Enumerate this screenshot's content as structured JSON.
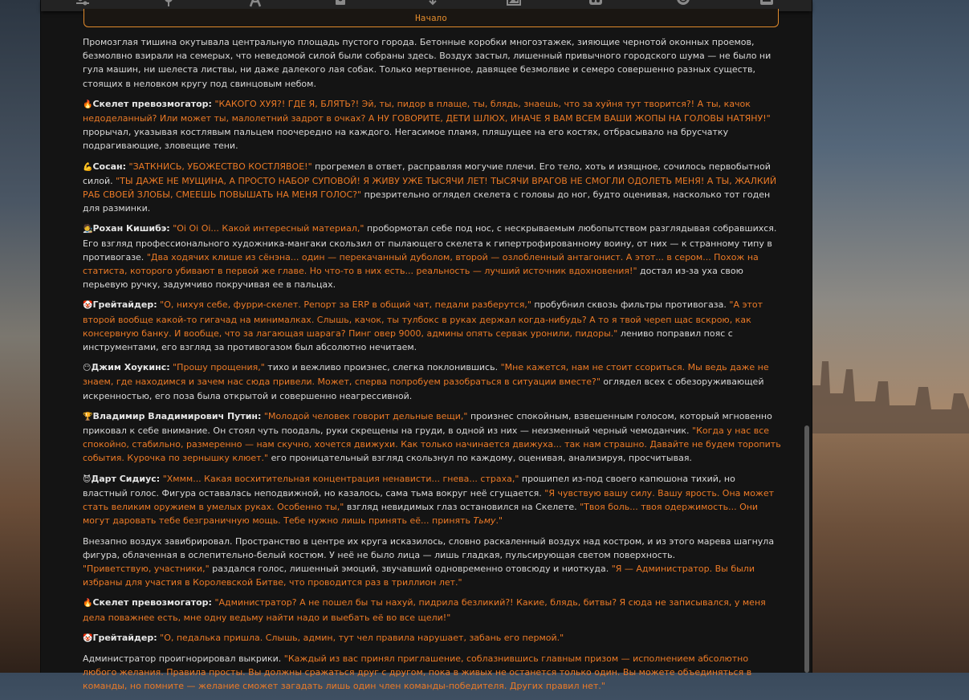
{
  "start_label": "Начало",
  "toolbar_icons": [
    "sliders-icon",
    "pin-icon",
    "font-icon",
    "journal-icon",
    "image-icon",
    "vr-icon",
    "smile-icon",
    "menu-card-icon"
  ],
  "paragraphs": [
    [
      {
        "t": "Промозглая тишина окутывала центральную площадь пустого города. Бетонные коробки многоэтажек, зияющие чернотой оконных проемов, безмолвно взирали на семерых, что неведомой силой были собраны здесь. Воздух застыл, лишенный привычного городского шума — не было ни гула машин, ни шелеста листвы, ни даже далекого лая собак. Только мертвенное, давящее безмолвие и семеро совершенно разных существ, стоящих в неловком кругу под свинцовым небом.",
        "s": "n"
      }
    ],
    [
      {
        "t": "🔥",
        "s": "e"
      },
      {
        "t": "Скелет превозмогатор:",
        "s": "b"
      },
      {
        "t": " ",
        "s": "n"
      },
      {
        "t": "\"КАКОГО ХУЯ?! ГДЕ Я, БЛЯТЬ?! Эй, ты, пидор в плаще, ты, блядь, знаешь, что за хуйня тут творится?! А ты, качок недоделанный? Или может ты, малолетний задрот в очках? А НУ ГОВОРИТЕ, ДЕТИ ШЛЮХ, ИНАЧЕ Я ВАМ ВСЕМ ВАШИ ЖОПЫ НА ГОЛОВЫ НАТЯНУ!\"",
        "s": "q"
      },
      {
        "t": " прорычал, указывая костлявым пальцем поочередно на каждого. Негасимое пламя, пляшущее на его костях, отбрасывало на брусчатку подрагивающие, зловещие тени.",
        "s": "n"
      }
    ],
    [
      {
        "t": "💪",
        "s": "e"
      },
      {
        "t": "Сосан:",
        "s": "b"
      },
      {
        "t": " ",
        "s": "n"
      },
      {
        "t": "\"ЗАТКНИСЬ, УБОЖЕСТВО КОСТЛЯВОЕ!\"",
        "s": "q"
      },
      {
        "t": " прогремел в ответ, расправляя могучие плечи. Его тело, хоть и изящное, сочилось первобытной силой. ",
        "s": "n"
      },
      {
        "t": "\"ТЫ ДАЖЕ НЕ МУЩИНА, А ПРОСТО НАБОР СУПОВОЙ! Я ЖИВУ УЖЕ ТЫСЯЧИ ЛЕТ! ТЫСЯЧИ ВРАГОВ НЕ СМОГЛИ ОДОЛЕТЬ МЕНЯ! А ТЫ, ЖАЛКИЙ РАБ СВОЕЙ ЗЛОБЫ, СМЕЕШЬ ПОВЫШАТЬ НА МЕНЯ ГОЛОС?\"",
        "s": "q"
      },
      {
        "t": " презрительно оглядел скелета с головы до ног, будто оценивая, насколько тот годен для разминки.",
        "s": "n"
      }
    ],
    [
      {
        "t": "🧑‍🎨",
        "s": "e"
      },
      {
        "t": "Рохан Кишибэ:",
        "s": "b"
      },
      {
        "t": " ",
        "s": "n"
      },
      {
        "t": "\"Oi Oi Oi... Какой интересный материал,\"",
        "s": "q"
      },
      {
        "t": " пробормотал себе под нос, с нескрываемым любопытством разглядывая собравшихся. Его взгляд профессионального художника-мангаки скользил от пылающего скелета к гипертрофированному воину, от них — к странному типу в противогазе. ",
        "s": "n"
      },
      {
        "t": "\"Два ходячих клише из сёнэна... один — перекачанный дуболом, второй — озлобленный антагонист. А этот... в сером... Похож на статиста, которого убивают в первой же главе. Но что-то в них есть... реальность — лучший источник вдохновения!\"",
        "s": "q"
      },
      {
        "t": " достал из-за уха свою перьевую ручку, задумчиво покручивая ее в пальцах.",
        "s": "n"
      }
    ],
    [
      {
        "t": "🤡",
        "s": "e"
      },
      {
        "t": "Грейтайдер:",
        "s": "b"
      },
      {
        "t": " ",
        "s": "n"
      },
      {
        "t": "\"О, нихуя себе, фурри-скелет. Репорт за ERP в общий чат, педали разберутся,\"",
        "s": "q"
      },
      {
        "t": " пробубнил сквозь фильтры противогаза. ",
        "s": "n"
      },
      {
        "t": "\"А этот второй вообще какой-то гигачад на минималках. Слышь, качок, ты тулбокс в руках держал когда-нибудь? А то я твой череп щас вскрою, как консервную банку. И вообще, что за лагающая шарага? Пинг овер 9000, админы опять сервак уронили, пидоры.\"",
        "s": "q"
      },
      {
        "t": " лениво поправил пояс с инструментами, его взгляд за противогазом был абсолютно нечитаем.",
        "s": "n"
      }
    ],
    [
      {
        "t": "😶",
        "s": "e"
      },
      {
        "t": "Джим Хоукинс:",
        "s": "b"
      },
      {
        "t": " ",
        "s": "n"
      },
      {
        "t": "\"Прошу прощения,\"",
        "s": "q"
      },
      {
        "t": " тихо и вежливо произнес, слегка поклонившись. ",
        "s": "n"
      },
      {
        "t": "\"Мне кажется, нам не стоит ссориться. Мы ведь даже не знаем, где находимся и зачем нас сюда привели. Может, сперва попробуем разобраться в ситуации вместе?\"",
        "s": "q"
      },
      {
        "t": " оглядел всех с обезоруживающей искренностью, его поза была открытой и совершенно неагрессивной.",
        "s": "n"
      }
    ],
    [
      {
        "t": "🏆",
        "s": "e"
      },
      {
        "t": "Владимир Владимирович Путин:",
        "s": "b"
      },
      {
        "t": " ",
        "s": "n"
      },
      {
        "t": "\"Молодой человек говорит дельные вещи,\"",
        "s": "q"
      },
      {
        "t": " произнес спокойным, взвешенным голосом, который мгновенно приковал к себе внимание. Он стоял чуть поодаль, руки скрещены на груди, в одной из них — неизменный черный чемоданчик. ",
        "s": "n"
      },
      {
        "t": "\"Когда у нас все спокойно, стабильно, размеренно — нам скучно, хочется движухи. Как только начинается движуха... так нам страшно. Давайте не будем торопить события. Курочка по зернышку клюет.\"",
        "s": "q"
      },
      {
        "t": " его проницательный взгляд скользнул по каждому, оценивая, анализируя, просчитывая.",
        "s": "n"
      }
    ],
    [
      {
        "t": "😈",
        "s": "e"
      },
      {
        "t": "Дарт Сидиус:",
        "s": "b"
      },
      {
        "t": " ",
        "s": "n"
      },
      {
        "t": "\"Хммм... Какая восхитительная концентрация ненависти... гнева... страха,\"",
        "s": "q"
      },
      {
        "t": " прошипел из-под своего капюшона тихий, но властный голос. Фигура оставалась неподвижной, но казалось, сама тьма вокруг неё сгущается. ",
        "s": "n"
      },
      {
        "t": "\"Я чувствую вашу силу. Вашу ярость. Она может стать великим оружием в умелых руках. Особенно ты,\"",
        "s": "q"
      },
      {
        "t": " взгляд невидимых глаз остановился на Скелете. ",
        "s": "n"
      },
      {
        "t": "\"Твоя боль... твоя одержимость... Они могут даровать тебе безграничную мощь. Тебе нужно лишь принять её... принять ",
        "s": "q"
      },
      {
        "t": "Тьму",
        "s": "qi"
      },
      {
        "t": ".\"",
        "s": "q"
      }
    ],
    [
      {
        "t": "Внезапно воздух завибрировал. Пространство в центре их круга исказилось, словно раскаленный воздух над костром, и из этого марева шагнула фигура, облаченная в ослепительно-белый костюм. У неё не было лица — лишь гладкая, пульсирующая светом поверхность.",
        "s": "n"
      },
      {
        "t": "\n",
        "s": "br"
      },
      {
        "t": "\"Приветствую, участники,\"",
        "s": "q"
      },
      {
        "t": " раздался голос, лишенный эмоций, звучавший одновременно отовсюду и ниоткуда. ",
        "s": "n"
      },
      {
        "t": "\"Я — Администратор. Вы были избраны для участия в Королевской Битве, что проводится раз в триллион лет.\"",
        "s": "q"
      }
    ],
    [
      {
        "t": "🔥",
        "s": "e"
      },
      {
        "t": "Скелет превозмогатор:",
        "s": "b"
      },
      {
        "t": " ",
        "s": "n"
      },
      {
        "t": "\"Администратор? А не пошел бы ты нахуй, пидрила безликий?! Какие, блядь, битвы? Я сюда не записывался, у меня дела поважнее есть, мне одну ведьму найти надо и выебать её во все щели!\"",
        "s": "q"
      }
    ],
    [
      {
        "t": "🤡",
        "s": "e"
      },
      {
        "t": "Грейтайдер:",
        "s": "b"
      },
      {
        "t": " ",
        "s": "n"
      },
      {
        "t": "\"О, педалька пришла. Слышь, админ, тут чел правила нарушает, забань его пермой.\"",
        "s": "q"
      }
    ],
    [
      {
        "t": "Администратор проигнорировал выкрики. ",
        "s": "n"
      },
      {
        "t": "\"Каждый из вас принял приглашение, соблазнившись главным призом — исполнением абсолютно любого желания. Правила просты. Вы должны сражаться друг с другом, пока в живых не останется только один. Вы можете объединяться в команды, но помните — желание сможет загадать лишь один член команды-победителя. Других правил нет.\"",
        "s": "q"
      }
    ]
  ]
}
